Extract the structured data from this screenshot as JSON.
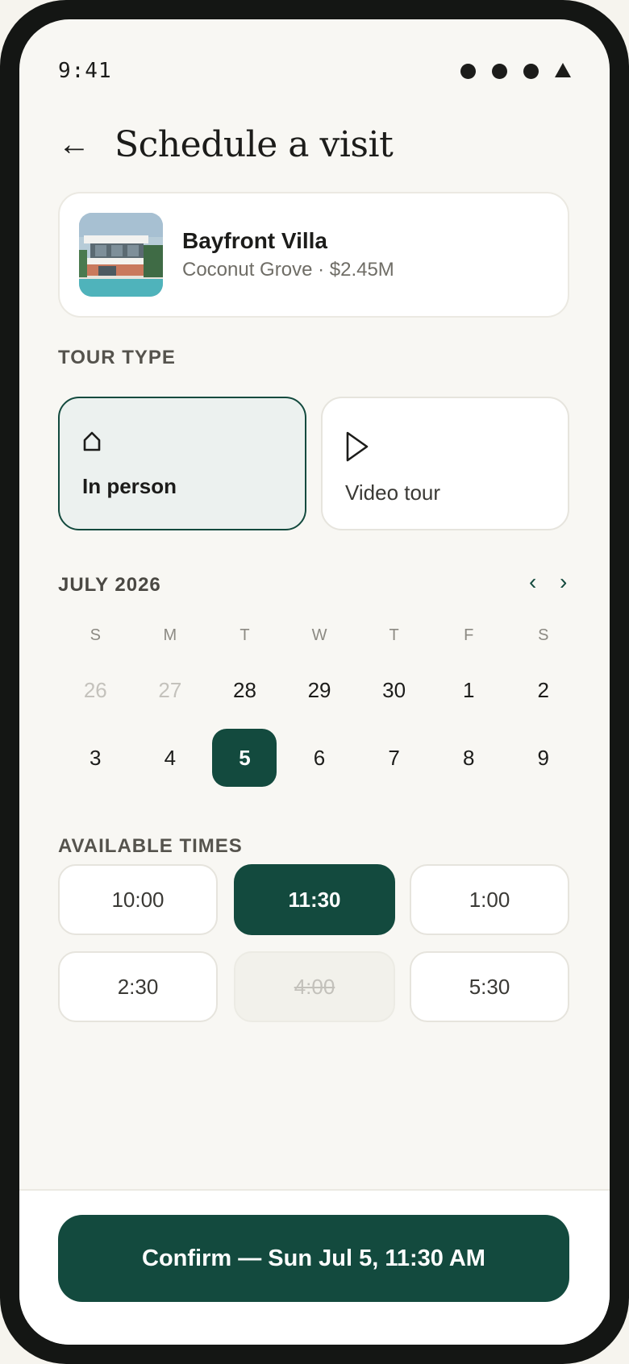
{
  "status_bar": {
    "time": "9:41"
  },
  "header": {
    "back_icon": "arrow-left-icon",
    "title": "Schedule a visit"
  },
  "listing": {
    "name": "Bayfront Villa",
    "subtitle": "Coconut Grove · $2.45M"
  },
  "tour_type": {
    "label": "TOUR TYPE",
    "options": [
      {
        "label": "In person",
        "icon": "house-icon",
        "selected": true
      },
      {
        "label": "Video tour",
        "icon": "play-icon",
        "selected": false
      }
    ]
  },
  "calendar": {
    "month_label": "JULY 2026",
    "prev_icon": "chevron-left-icon",
    "next_icon": "chevron-right-icon",
    "weekdays": [
      "S",
      "M",
      "T",
      "W",
      "T",
      "F",
      "S"
    ],
    "weeks": [
      [
        "26",
        "27",
        "28",
        "29",
        "30",
        "1",
        "2"
      ],
      [
        "3",
        "4",
        "5",
        "6",
        "7",
        "8",
        "9"
      ]
    ],
    "muted_days": [
      "26",
      "27"
    ],
    "selected_day": "5"
  },
  "times": {
    "label": "AVAILABLE TIMES",
    "slots": [
      {
        "time": "10:00",
        "state": "normal"
      },
      {
        "time": "11:30",
        "state": "selected"
      },
      {
        "time": "1:00",
        "state": "normal"
      },
      {
        "time": "2:30",
        "state": "normal"
      },
      {
        "time": "4:00",
        "state": "disabled"
      },
      {
        "time": "5:30",
        "state": "normal"
      }
    ]
  },
  "confirm": {
    "label": "Confirm — Sun Jul 5, 11:30 AM"
  },
  "colors": {
    "accent": "#134a3e",
    "background": "#f8f7f3",
    "selected_card_bg": "#ecf1ef"
  }
}
